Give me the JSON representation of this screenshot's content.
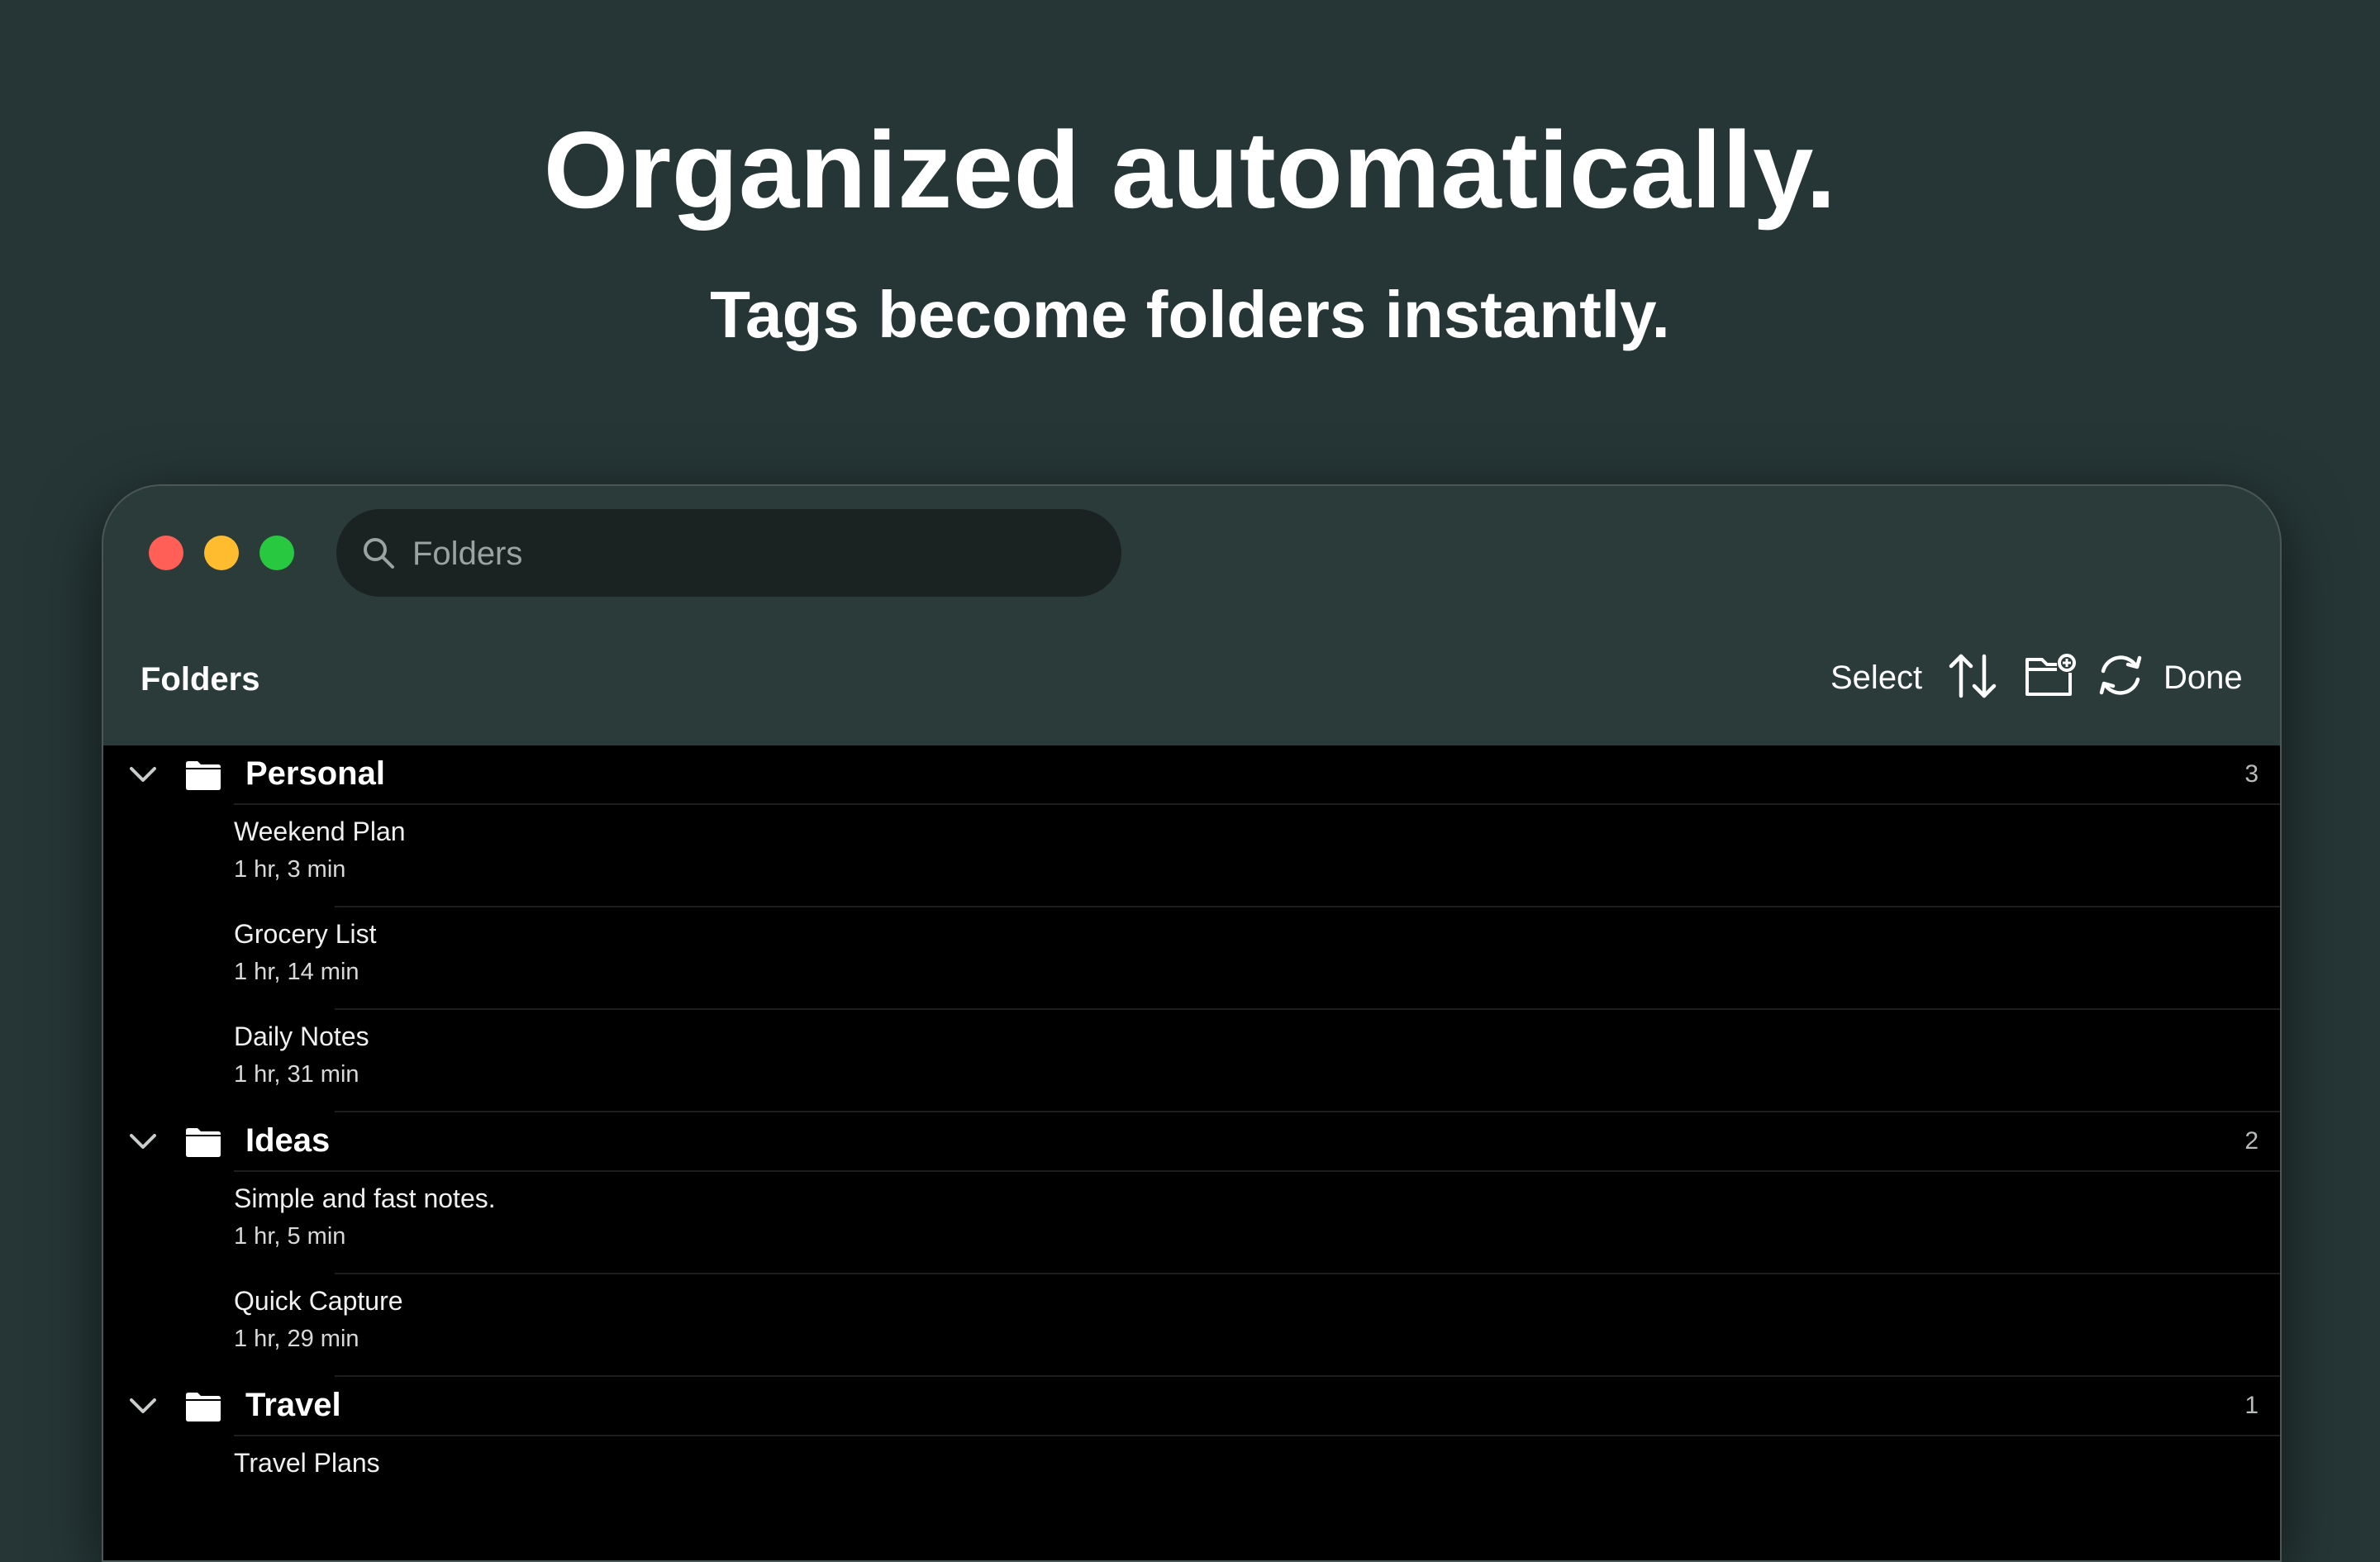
{
  "hero": {
    "headline": "Organized automatically.",
    "subheadline": "Tags become folders instantly."
  },
  "window": {
    "traffic_lights": {
      "close": "#ff5f57",
      "minimize": "#febc2e",
      "zoom": "#28c840"
    },
    "search": {
      "placeholder": "Folders",
      "icon": "search-icon"
    }
  },
  "toolbar": {
    "title": "Folders",
    "select_label": "Select",
    "sort_icon": "sort-arrows-icon",
    "new_folder_icon": "new-folder-icon",
    "sync_icon": "sync-icon",
    "done_label": "Done"
  },
  "groups": [
    {
      "name": "Personal",
      "count": "3",
      "notes": [
        {
          "title": "Weekend Plan",
          "subtitle": "1 hr, 3 min"
        },
        {
          "title": "Grocery List",
          "subtitle": "1 hr, 14 min"
        },
        {
          "title": "Daily Notes",
          "subtitle": "1 hr, 31 min"
        }
      ]
    },
    {
      "name": "Ideas",
      "count": "2",
      "notes": [
        {
          "title": "Simple and fast notes.",
          "subtitle": "1 hr, 5 min"
        },
        {
          "title": "Quick Capture",
          "subtitle": "1 hr, 29 min"
        }
      ]
    },
    {
      "name": "Travel",
      "count": "1",
      "notes": [
        {
          "title": "Travel Plans",
          "subtitle": ""
        }
      ]
    }
  ],
  "colors": {
    "background": "#263636",
    "window": "#2b3b3a",
    "list_background": "#000000",
    "text": "#ffffff"
  }
}
